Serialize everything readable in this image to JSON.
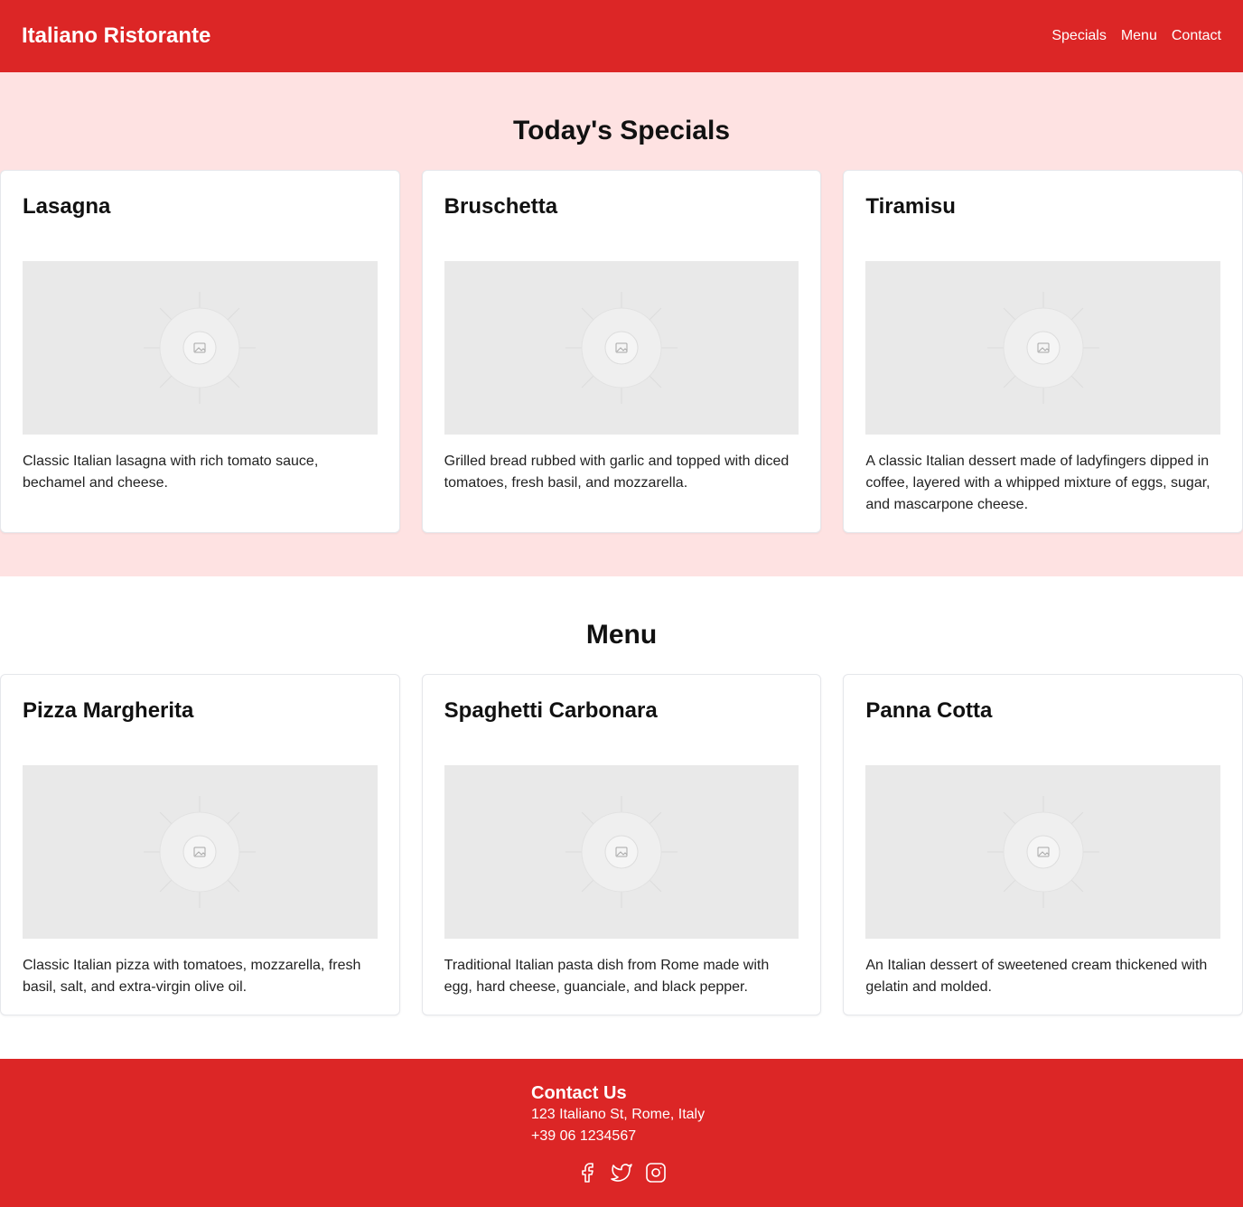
{
  "header": {
    "brand": "Italiano Ristorante",
    "nav": [
      "Specials",
      "Menu",
      "Contact"
    ]
  },
  "specials": {
    "title": "Today's Specials",
    "items": [
      {
        "name": "Lasagna",
        "description": "Classic Italian lasagna with rich tomato sauce, bechamel and cheese."
      },
      {
        "name": "Bruschetta",
        "description": "Grilled bread rubbed with garlic and topped with diced tomatoes, fresh basil, and mozzarella."
      },
      {
        "name": "Tiramisu",
        "description": "A classic Italian dessert made of ladyfingers dipped in coffee, layered with a whipped mixture of eggs, sugar, and mascarpone cheese."
      }
    ]
  },
  "menu": {
    "title": "Menu",
    "items": [
      {
        "name": "Pizza Margherita",
        "description": "Classic Italian pizza with tomatoes, mozzarella, fresh basil, salt, and extra-virgin olive oil."
      },
      {
        "name": "Spaghetti Carbonara",
        "description": "Traditional Italian pasta dish from Rome made with egg, hard cheese, guanciale, and black pepper."
      },
      {
        "name": "Panna Cotta",
        "description": "An Italian dessert of sweetened cream thickened with gelatin and molded."
      }
    ]
  },
  "footer": {
    "title": "Contact Us",
    "address": "123 Italiano St, Rome, Italy",
    "phone": "+39 06 1234567",
    "socials": [
      "facebook-icon",
      "twitter-icon",
      "instagram-icon"
    ]
  },
  "colors": {
    "brand": "#dc2626",
    "specials_bg": "#fee2e2"
  }
}
